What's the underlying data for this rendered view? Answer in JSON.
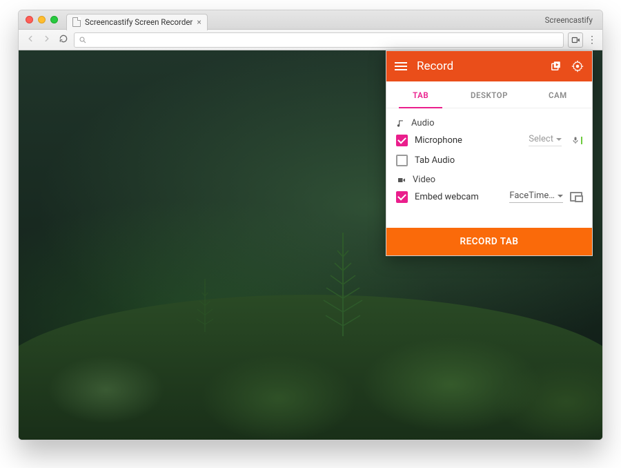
{
  "chrome": {
    "tab_title": "Screencastify Screen Recorder",
    "brand": "Screencastify"
  },
  "popup": {
    "title": "Record",
    "tabs": {
      "tab": "TAB",
      "desktop": "DESKTOP",
      "cam": "CAM"
    },
    "audio_label": "Audio",
    "microphone_label": "Microphone",
    "microphone_select": "Select",
    "tabaudio_label": "Tab Audio",
    "video_label": "Video",
    "embedwebcam_label": "Embed webcam",
    "webcam_device": "FaceTime…",
    "record_button": "RECORD TAB"
  }
}
